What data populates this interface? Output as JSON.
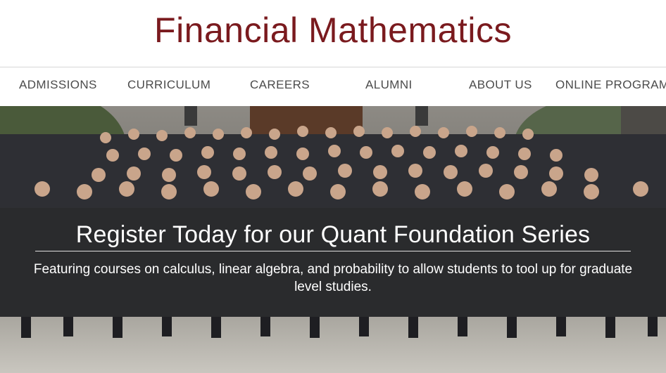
{
  "site": {
    "title": "Financial Mathematics",
    "brand_color": "#7a1a1e"
  },
  "nav": {
    "items": [
      {
        "label": "ADMISSIONS"
      },
      {
        "label": "CURRICULUM"
      },
      {
        "label": "CAREERS"
      },
      {
        "label": "ALUMNI"
      },
      {
        "label": "ABOUT US"
      },
      {
        "label": "ONLINE PROGRAM"
      }
    ]
  },
  "hero": {
    "image": "group-photo-of-students",
    "title": "Register Today for our Quant Foundation Series",
    "subtitle": "Featuring courses on calculus, linear algebra, and probability to allow students to tool up for graduate level studies."
  }
}
